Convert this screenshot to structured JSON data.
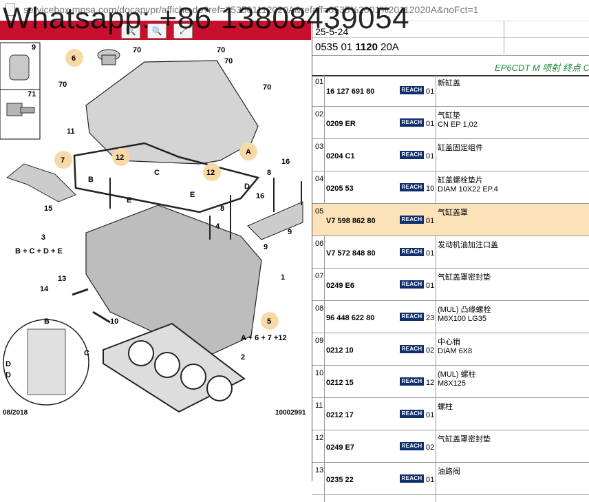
{
  "browser": {
    "url": "servicebox.mpsa.com/docapvpr/affiche.do?ref=053501112020A&refaff=0535%2001%20112020A&noFct=1"
  },
  "overlay": {
    "watermark": "Whatsapp: +86 13808439054"
  },
  "diagram": {
    "footer_left": "08/2018",
    "footer_right": "10002991",
    "callouts": [
      "9",
      "71",
      "6",
      "70",
      "70",
      "70",
      "70",
      "70",
      "11",
      "A",
      "7",
      "12",
      "C",
      "12",
      "16",
      "8",
      "E",
      "B",
      "D",
      "15",
      "E",
      "8",
      "16",
      "4",
      "9",
      "3",
      "B + C + D + E",
      "13",
      "14",
      "1",
      "10",
      "5",
      "A + 6 + 7 +12",
      "2",
      "B",
      "C",
      "D",
      "D"
    ]
  },
  "header": {
    "date": "25-5-24",
    "ref_prefix": "0535 01",
    "ref_bold": "1120",
    "ref_suffix": "20A",
    "model": "EP6CDT M 喷射 终点 C"
  },
  "reach_label": "REACH",
  "rows": [
    {
      "idx": "01",
      "part": "16 127 691 80",
      "qty": "01",
      "desc": "新缸盖",
      "desc2": ""
    },
    {
      "idx": "02",
      "part": "0209 ER",
      "qty": "01",
      "desc": "气缸垫",
      "desc2": "CN EP 1,02"
    },
    {
      "idx": "03",
      "part": "0204 C1",
      "qty": "01",
      "desc": "缸盖固定组件",
      "desc2": ""
    },
    {
      "idx": "04",
      "part": "0205 53",
      "qty": "10",
      "desc": "缸盖螺栓垫片",
      "desc2": "DIAM 10X22 EP.4"
    },
    {
      "idx": "05",
      "part": "V7 598 862 80",
      "qty": "01",
      "desc": "气缸盖罩",
      "desc2": ""
    },
    {
      "idx": "06",
      "part": "V7 572 848 80",
      "qty": "01",
      "desc": "发动机油加注口盖",
      "desc2": ""
    },
    {
      "idx": "07",
      "part": "0249 E6",
      "qty": "01",
      "desc": "气缸盖罩密封垫",
      "desc2": ""
    },
    {
      "idx": "08",
      "part": "96 448 622 80",
      "qty": "23",
      "desc": "(MUL) 凸缘螺栓",
      "desc2": "M6X100 LG35"
    },
    {
      "idx": "09",
      "part": "0212 10",
      "qty": "02",
      "desc": "中心销",
      "desc2": "DIAM 6X8"
    },
    {
      "idx": "10",
      "part": "0212 15",
      "qty": "12",
      "desc": "(MUL) 螺柱",
      "desc2": "M8X125"
    },
    {
      "idx": "11",
      "part": "0212 17",
      "qty": "01",
      "desc": "螺柱",
      "desc2": ""
    },
    {
      "idx": "12",
      "part": "0249 E7",
      "qty": "02",
      "desc": "气缸盖罩密封垫",
      "desc2": ""
    },
    {
      "idx": "13",
      "part": "0235 22",
      "qty": "01",
      "desc": "油路阀",
      "desc2": ""
    }
  ],
  "colors": {
    "brand_red": "#c8102e",
    "highlight": "#fbe2b8",
    "model_green": "#1d8a3a",
    "reach_navy": "#0f2f6e"
  }
}
